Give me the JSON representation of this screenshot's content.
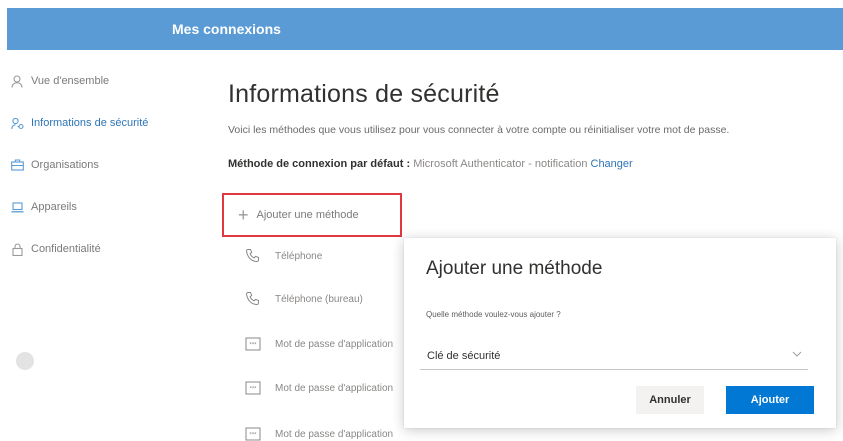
{
  "header": {
    "title": "Mes connexions"
  },
  "sidebar": {
    "items": [
      {
        "label": "Vue d'ensemble",
        "icon": "person-icon",
        "active": false
      },
      {
        "label": "Informations de sécurité",
        "icon": "security-info-icon",
        "active": true
      },
      {
        "label": "Organisations",
        "icon": "briefcase-icon",
        "active": false
      },
      {
        "label": "Appareils",
        "icon": "laptop-icon",
        "active": false
      },
      {
        "label": "Confidentialité",
        "icon": "lock-icon",
        "active": false
      }
    ]
  },
  "main": {
    "title": "Informations de sécurité",
    "description": "Voici les méthodes que vous utilisez pour vous connecter à votre compte ou réinitialiser votre mot de passe.",
    "default_method_label": "Méthode de connexion par défaut :",
    "default_method_value": "Microsoft Authenticator - notification",
    "default_method_change": "Changer",
    "add_method_label": "Ajouter une méthode",
    "methods": [
      {
        "label": "Téléphone",
        "icon": "phone-icon"
      },
      {
        "label": "Téléphone (bureau)",
        "icon": "phone-icon"
      },
      {
        "label": "Mot de passe d'application",
        "icon": "password-icon"
      },
      {
        "label": "Mot de passe d'application",
        "icon": "password-icon"
      },
      {
        "label": "Mot de passe d'application",
        "icon": "password-icon"
      }
    ]
  },
  "dialog": {
    "title": "Ajouter une méthode",
    "question": "Quelle méthode voulez-vous ajouter ?",
    "selected_option": "Clé de sécurité",
    "cancel_label": "Annuler",
    "add_label": "Ajouter"
  },
  "colors": {
    "header_bg": "#5b9bd5",
    "accent": "#0078d4",
    "active_nav": "#2e74b5",
    "highlight_border": "#e0383e"
  }
}
